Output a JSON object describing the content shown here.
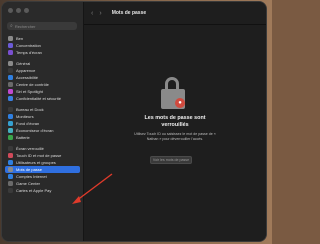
{
  "window": {
    "title": "Mots de passe"
  },
  "search": {
    "placeholder": "Rechercher"
  },
  "sidebar": {
    "items": [
      {
        "label": "Ben",
        "color": "#8a8a8a"
      },
      {
        "label": "Concentration",
        "color": "#6b5bd6"
      },
      {
        "label": "Temps d'écran",
        "color": "#7a4fd0"
      },
      {
        "label": "Général",
        "color": "#8a8a8a"
      },
      {
        "label": "Apparence",
        "color": "#3a3a3a"
      },
      {
        "label": "Accessibilité",
        "color": "#2f7fe0"
      },
      {
        "label": "Centre de contrôle",
        "color": "#6a6a6a"
      },
      {
        "label": "Siri et Spotlight",
        "color": "#c04ad0"
      },
      {
        "label": "Confidentialité et sécurité",
        "color": "#3a7fe0"
      },
      {
        "label": "Bureau et Dock",
        "color": "#3a3a3a"
      },
      {
        "label": "Moniteurs",
        "color": "#2f7fe0"
      },
      {
        "label": "Fond d'écran",
        "color": "#35a0d0"
      },
      {
        "label": "Économiseur d'écran",
        "color": "#45b0c0"
      },
      {
        "label": "Batterie",
        "color": "#3aa54a"
      },
      {
        "label": "Écran verrouillé",
        "color": "#3a3a3a"
      },
      {
        "label": "Touch ID et mot de passe",
        "color": "#d04a5a"
      },
      {
        "label": "Utilisateurs et groupes",
        "color": "#2f7fe0"
      },
      {
        "label": "Mots de passe",
        "color": "#8a8a8a",
        "selected": true
      },
      {
        "label": "Comptes Internet",
        "color": "#2f7fe0"
      },
      {
        "label": "Game Center",
        "color": "#6a6a6a"
      },
      {
        "label": "Cartes et Apple Pay",
        "color": "#3a3a3a"
      }
    ]
  },
  "main": {
    "heading": "Les mots de passe sont verrouillés",
    "description": "Utilisez Touch ID ou saisissez le mot de passe de « Nathan » pour déverrouiller l'accès.",
    "unlock_button": "Voir les mots de passe"
  }
}
